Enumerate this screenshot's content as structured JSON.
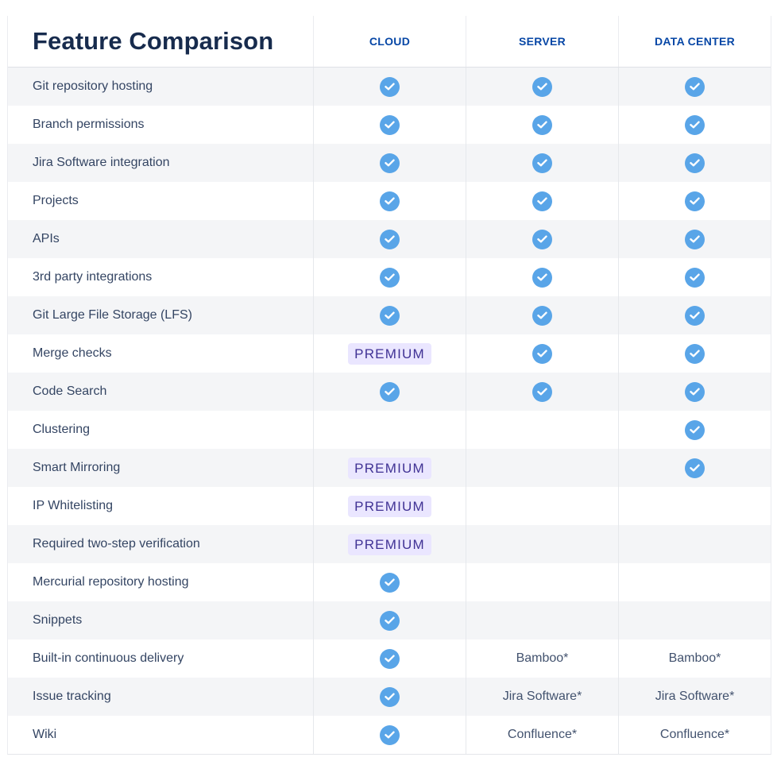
{
  "title": "Feature Comparison",
  "columns": [
    "CLOUD",
    "SERVER",
    "DATA CENTER"
  ],
  "icons": {
    "check": "check-circle-icon"
  },
  "colors": {
    "check": "#59a5e8",
    "premium_bg": "#eae6ff",
    "premium_text": "#403294",
    "header_text": "#0747a6"
  },
  "rows": [
    {
      "feature": "Git repository hosting",
      "cells": [
        {
          "type": "check"
        },
        {
          "type": "check"
        },
        {
          "type": "check"
        }
      ]
    },
    {
      "feature": "Branch permissions",
      "cells": [
        {
          "type": "check"
        },
        {
          "type": "check"
        },
        {
          "type": "check"
        }
      ]
    },
    {
      "feature": "Jira Software integration",
      "cells": [
        {
          "type": "check"
        },
        {
          "type": "check"
        },
        {
          "type": "check"
        }
      ]
    },
    {
      "feature": "Projects",
      "cells": [
        {
          "type": "check"
        },
        {
          "type": "check"
        },
        {
          "type": "check"
        }
      ]
    },
    {
      "feature": "APIs",
      "cells": [
        {
          "type": "check"
        },
        {
          "type": "check"
        },
        {
          "type": "check"
        }
      ]
    },
    {
      "feature": "3rd party integrations",
      "cells": [
        {
          "type": "check"
        },
        {
          "type": "check"
        },
        {
          "type": "check"
        }
      ]
    },
    {
      "feature": "Git Large File Storage (LFS)",
      "cells": [
        {
          "type": "check"
        },
        {
          "type": "check"
        },
        {
          "type": "check"
        }
      ]
    },
    {
      "feature": "Merge checks",
      "cells": [
        {
          "type": "badge",
          "text": "PREMIUM"
        },
        {
          "type": "check"
        },
        {
          "type": "check"
        }
      ]
    },
    {
      "feature": "Code Search",
      "cells": [
        {
          "type": "check"
        },
        {
          "type": "check"
        },
        {
          "type": "check"
        }
      ]
    },
    {
      "feature": "Clustering",
      "cells": [
        {
          "type": "empty"
        },
        {
          "type": "empty"
        },
        {
          "type": "check"
        }
      ]
    },
    {
      "feature": "Smart Mirroring",
      "cells": [
        {
          "type": "badge",
          "text": "PREMIUM"
        },
        {
          "type": "empty"
        },
        {
          "type": "check"
        }
      ]
    },
    {
      "feature": "IP Whitelisting",
      "cells": [
        {
          "type": "badge",
          "text": "PREMIUM"
        },
        {
          "type": "empty"
        },
        {
          "type": "empty"
        }
      ]
    },
    {
      "feature": "Required two-step verification",
      "cells": [
        {
          "type": "badge",
          "text": "PREMIUM"
        },
        {
          "type": "empty"
        },
        {
          "type": "empty"
        }
      ]
    },
    {
      "feature": "Mercurial repository hosting",
      "cells": [
        {
          "type": "check"
        },
        {
          "type": "empty"
        },
        {
          "type": "empty"
        }
      ]
    },
    {
      "feature": "Snippets",
      "cells": [
        {
          "type": "check"
        },
        {
          "type": "empty"
        },
        {
          "type": "empty"
        }
      ]
    },
    {
      "feature": "Built-in continuous delivery",
      "cells": [
        {
          "type": "check"
        },
        {
          "type": "text",
          "text": "Bamboo*"
        },
        {
          "type": "text",
          "text": "Bamboo*"
        }
      ]
    },
    {
      "feature": "Issue tracking",
      "cells": [
        {
          "type": "check"
        },
        {
          "type": "text",
          "text": "Jira Software*"
        },
        {
          "type": "text",
          "text": "Jira Software*"
        }
      ]
    },
    {
      "feature": "Wiki",
      "cells": [
        {
          "type": "check"
        },
        {
          "type": "text",
          "text": "Confluence*"
        },
        {
          "type": "text",
          "text": "Confluence*"
        }
      ]
    }
  ]
}
